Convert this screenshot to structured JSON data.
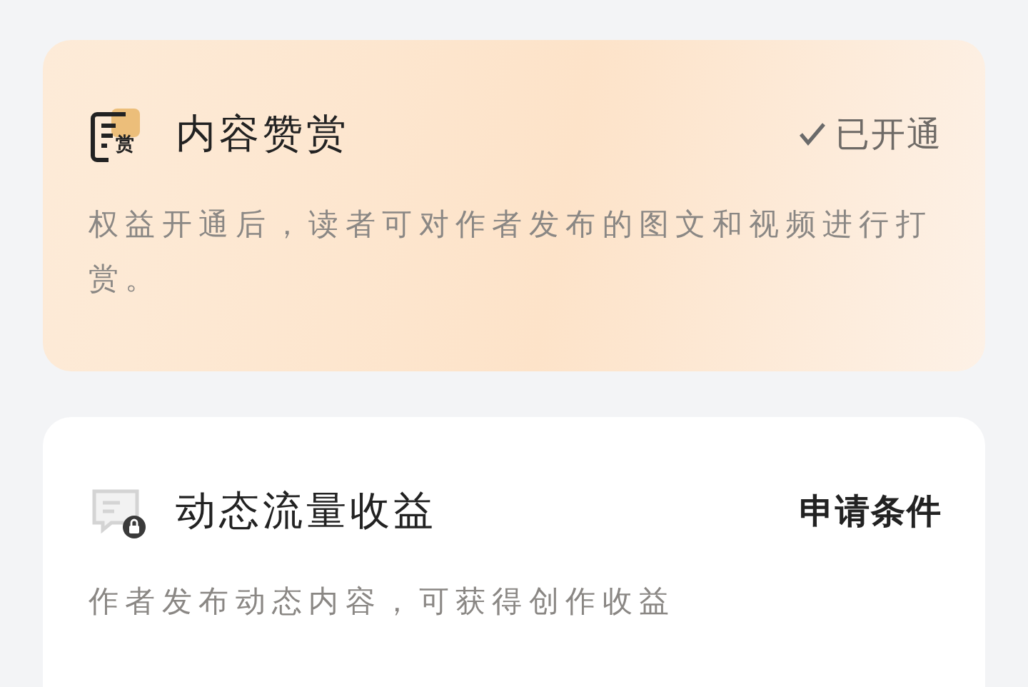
{
  "cards": [
    {
      "title": "内容赞赏",
      "icon_text": "赏",
      "locked": false,
      "highlighted": true,
      "kind": "status",
      "status": "已开通",
      "description": "权益开通后，读者可对作者发布的图文和视频进行打赏。"
    },
    {
      "title": "动态流量收益",
      "locked": true,
      "highlighted": false,
      "kind": "action",
      "status": "申请条件",
      "description": "作者发布动态内容，可获得创作收益"
    }
  ]
}
